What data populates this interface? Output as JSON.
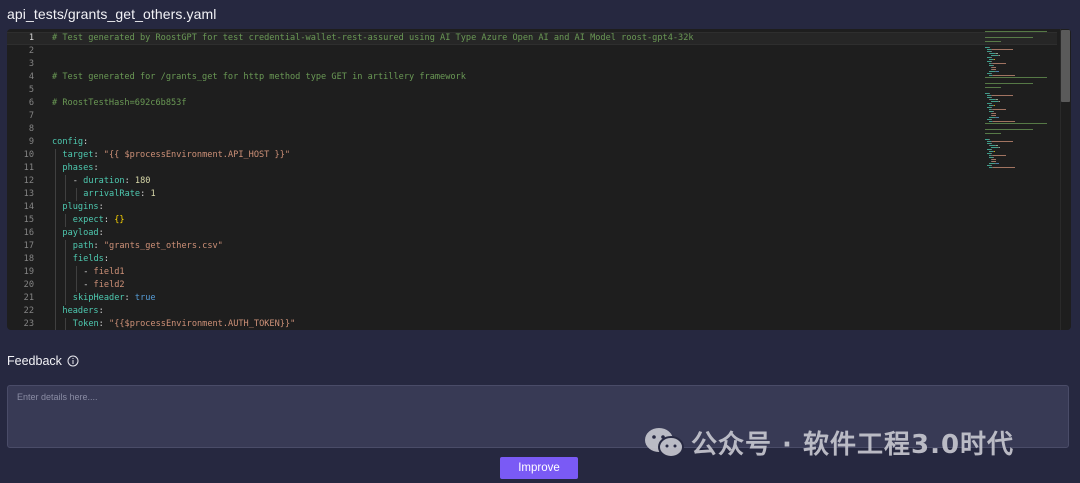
{
  "file": {
    "title": "api_tests/grants_get_others.yaml"
  },
  "editor": {
    "active_line": 1,
    "lines": [
      {
        "n": "1",
        "indent": 0,
        "tokens": [
          {
            "t": "# Test generated by RoostGPT for test credential-wallet-rest-assured using AI Type Azure Open AI and AI Model roost-gpt4-32k",
            "c": "comment"
          }
        ]
      },
      {
        "n": "2",
        "indent": 0,
        "tokens": []
      },
      {
        "n": "3",
        "indent": 0,
        "tokens": []
      },
      {
        "n": "4",
        "indent": 0,
        "tokens": [
          {
            "t": "# Test generated for /grants_get for http method type GET in artillery framework",
            "c": "comment"
          }
        ]
      },
      {
        "n": "5",
        "indent": 0,
        "tokens": []
      },
      {
        "n": "6",
        "indent": 0,
        "tokens": [
          {
            "t": "# RoostTestHash=692c6b853f",
            "c": "comment"
          }
        ]
      },
      {
        "n": "7",
        "indent": 0,
        "tokens": []
      },
      {
        "n": "8",
        "indent": 0,
        "tokens": []
      },
      {
        "n": "9",
        "indent": 0,
        "tokens": [
          {
            "t": "config",
            "c": "key"
          },
          {
            "t": ":",
            "c": "punc"
          }
        ]
      },
      {
        "n": "10",
        "indent": 1,
        "tokens": [
          {
            "t": "target",
            "c": "key"
          },
          {
            "t": ": ",
            "c": "punc"
          },
          {
            "t": "\"{{ $processEnvironment.API_HOST }}\"",
            "c": "str"
          }
        ]
      },
      {
        "n": "11",
        "indent": 1,
        "tokens": [
          {
            "t": "phases",
            "c": "key"
          },
          {
            "t": ":",
            "c": "punc"
          }
        ]
      },
      {
        "n": "12",
        "indent": 2,
        "tokens": [
          {
            "t": "- ",
            "c": "punc"
          },
          {
            "t": "duration",
            "c": "key"
          },
          {
            "t": ": ",
            "c": "punc"
          },
          {
            "t": "180",
            "c": "num"
          }
        ]
      },
      {
        "n": "13",
        "indent": 3,
        "tokens": [
          {
            "t": "arrivalRate",
            "c": "key"
          },
          {
            "t": ": ",
            "c": "punc"
          },
          {
            "t": "1",
            "c": "num"
          }
        ]
      },
      {
        "n": "14",
        "indent": 1,
        "tokens": [
          {
            "t": "plugins",
            "c": "key"
          },
          {
            "t": ":",
            "c": "punc"
          }
        ]
      },
      {
        "n": "15",
        "indent": 2,
        "tokens": [
          {
            "t": "expect",
            "c": "key"
          },
          {
            "t": ": ",
            "c": "punc"
          },
          {
            "t": "{}",
            "c": "brace"
          }
        ]
      },
      {
        "n": "16",
        "indent": 1,
        "tokens": [
          {
            "t": "payload",
            "c": "key"
          },
          {
            "t": ":",
            "c": "punc"
          }
        ]
      },
      {
        "n": "17",
        "indent": 2,
        "tokens": [
          {
            "t": "path",
            "c": "key"
          },
          {
            "t": ": ",
            "c": "punc"
          },
          {
            "t": "\"grants_get_others.csv\"",
            "c": "str"
          }
        ]
      },
      {
        "n": "18",
        "indent": 2,
        "tokens": [
          {
            "t": "fields",
            "c": "key"
          },
          {
            "t": ":",
            "c": "punc"
          }
        ]
      },
      {
        "n": "19",
        "indent": 3,
        "tokens": [
          {
            "t": "- ",
            "c": "punc"
          },
          {
            "t": "field1",
            "c": "str"
          }
        ]
      },
      {
        "n": "20",
        "indent": 3,
        "tokens": [
          {
            "t": "- ",
            "c": "punc"
          },
          {
            "t": "field2",
            "c": "str"
          }
        ]
      },
      {
        "n": "21",
        "indent": 2,
        "tokens": [
          {
            "t": "skipHeader",
            "c": "key"
          },
          {
            "t": ": ",
            "c": "punc"
          },
          {
            "t": "true",
            "c": "bool"
          }
        ]
      },
      {
        "n": "22",
        "indent": 1,
        "tokens": [
          {
            "t": "headers",
            "c": "key"
          },
          {
            "t": ":",
            "c": "punc"
          }
        ]
      },
      {
        "n": "23",
        "indent": 2,
        "tokens": [
          {
            "t": "Token",
            "c": "key"
          },
          {
            "t": ": ",
            "c": "punc"
          },
          {
            "t": "\"{{$processEnvironment.AUTH_TOKEN}}\"",
            "c": "str"
          }
        ]
      }
    ]
  },
  "feedback": {
    "label": "Feedback",
    "info_icon": "info-circle-icon",
    "placeholder": "Enter details here....",
    "value": ""
  },
  "watermark": {
    "text": "公众号 · 软件工程3.0时代",
    "icon": "wechat-icon"
  },
  "actions": {
    "improve_label": "Improve"
  },
  "colors": {
    "accent": "#7a5af5",
    "background": "#262840",
    "editor_bg": "#1e1e1e"
  }
}
